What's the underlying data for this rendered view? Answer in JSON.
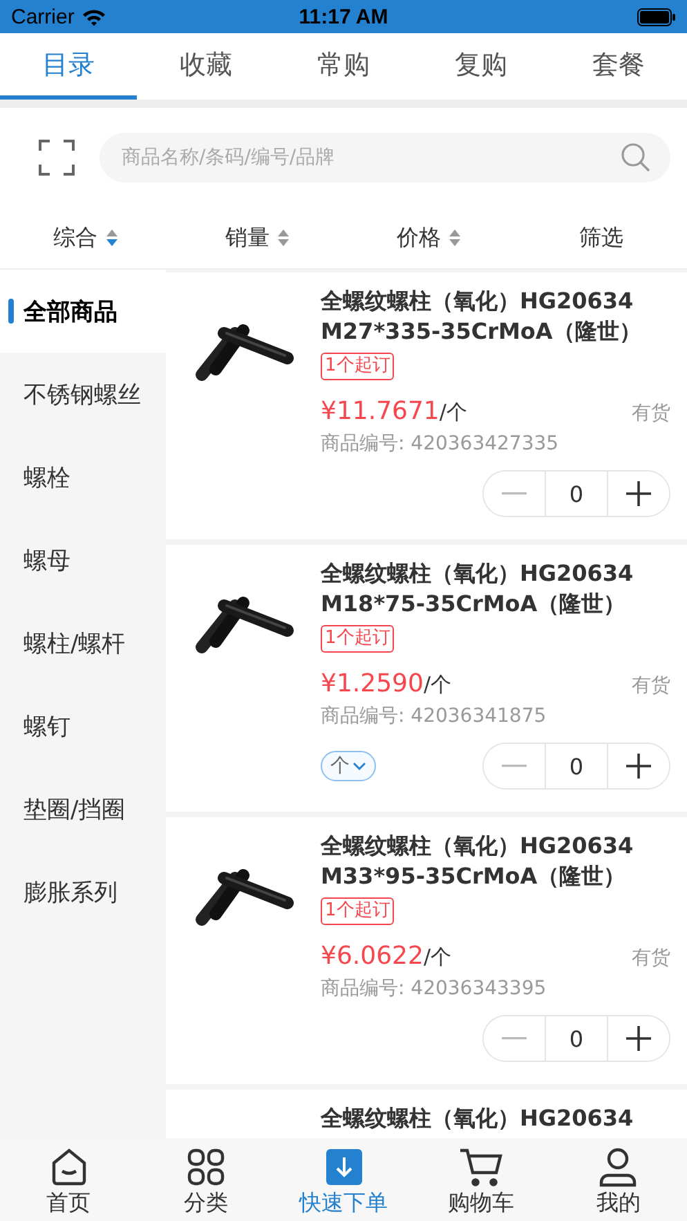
{
  "status_bar": {
    "carrier": "Carrier",
    "time": "11:17 AM"
  },
  "tabs": [
    {
      "label": "目录",
      "selected": true
    },
    {
      "label": "收藏",
      "selected": false
    },
    {
      "label": "常购",
      "selected": false
    },
    {
      "label": "复购",
      "selected": false
    },
    {
      "label": "套餐",
      "selected": false
    }
  ],
  "search": {
    "placeholder": "商品名称/条码/编号/品牌"
  },
  "sort_bar": [
    {
      "label": "综合",
      "kind": "sort",
      "active": true
    },
    {
      "label": "销量",
      "kind": "sort",
      "active": false
    },
    {
      "label": "价格",
      "kind": "sort",
      "active": false
    },
    {
      "label": "筛选",
      "kind": "filter"
    }
  ],
  "sidebar": {
    "items": [
      {
        "label": "全部商品",
        "selected": true
      },
      {
        "label": "不锈钢螺丝",
        "selected": false
      },
      {
        "label": "螺栓",
        "selected": false
      },
      {
        "label": "螺母",
        "selected": false
      },
      {
        "label": "螺柱/螺杆",
        "selected": false
      },
      {
        "label": "螺钉",
        "selected": false
      },
      {
        "label": "垫圈/挡圈",
        "selected": false
      },
      {
        "label": "膨胀系列",
        "selected": false
      }
    ]
  },
  "products": [
    {
      "title": "全螺纹螺柱（氧化）HG20634 M27*335-35CrMoA（隆世）",
      "tag": "1个起订",
      "price": "¥11.7671",
      "unit": "/个",
      "stock": "有货",
      "code": "商品编号: 420363427335",
      "quantity": "0"
    },
    {
      "title": "全螺纹螺柱（氧化）HG20634 M18*75-35CrMoA（隆世）",
      "tag": "1个起订",
      "price": "¥1.2590",
      "unit": "/个",
      "stock": "有货",
      "code": "商品编号: 42036341875",
      "unit_selector": "个",
      "quantity": "0"
    },
    {
      "title": "全螺纹螺柱（氧化）HG20634 M33*95-35CrMoA（隆世）",
      "tag": "1个起订",
      "price": "¥6.0622",
      "unit": "/个",
      "stock": "有货",
      "code": "商品编号: 42036343395",
      "quantity": "0"
    },
    {
      "title": "全螺纹螺柱（氧化）HG20634"
    }
  ],
  "bottom_nav": [
    {
      "label": "首页",
      "selected": false
    },
    {
      "label": "分类",
      "selected": false
    },
    {
      "label": "快速下单",
      "selected": true
    },
    {
      "label": "购物车",
      "selected": false
    },
    {
      "label": "我的",
      "selected": false
    }
  ]
}
